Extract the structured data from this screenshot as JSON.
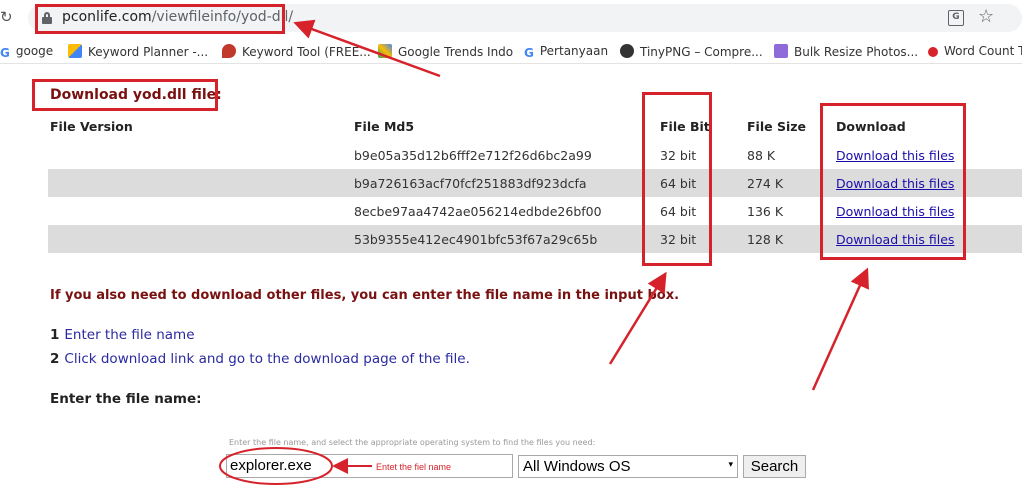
{
  "browser": {
    "url_host": "pconlife.com",
    "url_path": "/viewfileinfo/yod-dll/",
    "bookmarks": [
      {
        "label": "googe",
        "icon": "google-icon",
        "color": "#4285f4"
      },
      {
        "label": "Keyword Planner -...",
        "icon": "google-ads-icon",
        "color": "#fbbc04"
      },
      {
        "label": "Keyword Tool (FREE...",
        "icon": "keyword-tool-icon",
        "color": "#c0392b"
      },
      {
        "label": "Google Trends Indo",
        "icon": "google-trends-icon",
        "color": "#34a853"
      },
      {
        "label": "Pertanyaan",
        "icon": "google-icon",
        "color": "#4285f4"
      },
      {
        "label": "TinyPNG – Compre...",
        "icon": "tinypng-icon",
        "color": "#333333"
      },
      {
        "label": "Bulk Resize Photos...",
        "icon": "bulk-resize-icon",
        "color": "#8e6bd8"
      },
      {
        "label": "Word Count T",
        "icon": "word-count-icon",
        "color": "#d6232b"
      }
    ]
  },
  "page": {
    "heading": "Download yod.dll file:",
    "table": {
      "headers": {
        "version": "File Version",
        "md5": "File Md5",
        "bit": "File Bit",
        "size": "File Size",
        "download": "Download"
      },
      "rows": [
        {
          "version": "",
          "md5": "b9e05a35d12b6fff2e712f26d6bc2a99",
          "bit": "32 bit",
          "size": "88 K",
          "download": "Download this files"
        },
        {
          "version": "",
          "md5": "b9a726163acf70fcf251883df923dcfa",
          "bit": "64 bit",
          "size": "274 K",
          "download": "Download this files"
        },
        {
          "version": "",
          "md5": "8ecbe97aa4742ae056214edbde26bf00",
          "bit": "64 bit",
          "size": "136 K",
          "download": "Download this files"
        },
        {
          "version": "",
          "md5": "53b9355e412ec4901bfc53f67a29c65b",
          "bit": "32 bit",
          "size": "128 K",
          "download": "Download this files"
        }
      ]
    },
    "intro": "If you also need to download other files, you can enter the file name in the input box.",
    "steps": [
      {
        "num": "1",
        "text": "Enter the file name"
      },
      {
        "num": "2",
        "text": "Click download link and go to the download page of the file."
      }
    ],
    "enter_label": "Enter the file name:",
    "search": {
      "hint": "Enter the file name, and select the appropriate operating system to find the files you need:",
      "input_value": "explorer.exe",
      "os_selected": "All Windows OS",
      "button": "Search"
    }
  },
  "annotations": {
    "input_note": "Entet the fiel name",
    "color": "#d6232b"
  }
}
